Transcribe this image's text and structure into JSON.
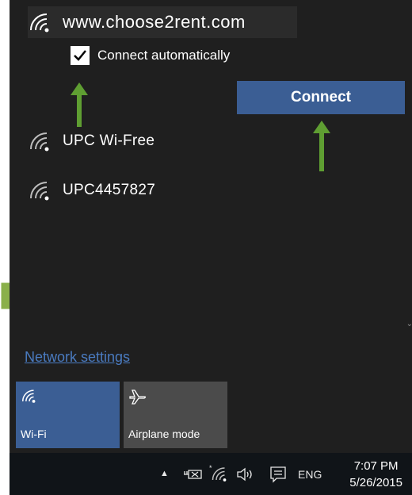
{
  "networks": {
    "selected": {
      "name": "www.choose2rent.com"
    },
    "auto_connect_label": "Connect automatically",
    "auto_connect_checked": true,
    "connect_label": "Connect",
    "others": [
      {
        "name": "UPC Wi-Free"
      },
      {
        "name": "UPC4457827"
      }
    ]
  },
  "network_settings_label": "Network settings",
  "quick_actions": {
    "wifi_label": "Wi-Fi",
    "airplane_label": "Airplane mode"
  },
  "taskbar": {
    "language": "ENG",
    "time": "7:07 PM",
    "date": "5/26/2015"
  },
  "colors": {
    "accent": "#3b5e94",
    "link": "#4a7bc0",
    "annotation_arrow": "#6fa33a"
  },
  "icons": {
    "wifi": "wifi-signal-icon",
    "airplane": "airplane-icon",
    "check": "check-icon",
    "chevron": "chevron-up-icon",
    "battery": "battery-plug-icon",
    "volume": "volume-icon",
    "notification": "action-center-icon"
  }
}
